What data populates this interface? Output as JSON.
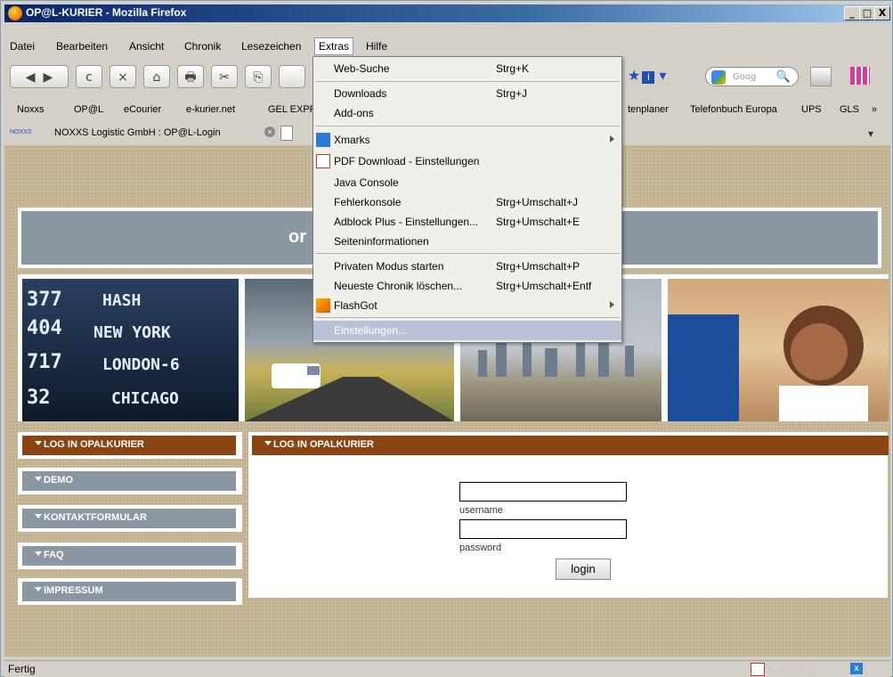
{
  "window": {
    "title": "OP@L-KURIER - Mozilla Firefox",
    "controls": {
      "minimize": "_",
      "maximize": "□",
      "close": "X"
    }
  },
  "menubar": {
    "items": [
      {
        "label": "Datei"
      },
      {
        "label": "Bearbeiten"
      },
      {
        "label": "Ansicht"
      },
      {
        "label": "Chronik"
      },
      {
        "label": "Lesezeichen"
      },
      {
        "label": "Extras"
      },
      {
        "label": "Hilfe"
      }
    ]
  },
  "toolbar": {
    "back": "◀",
    "forward": "▶",
    "reload": "c",
    "stop": "×",
    "home": "⌂",
    "print": "🖶",
    "cut": "✂",
    "copy": "⎘",
    "search_placeholder": "Goog",
    "search_icon": "🔍"
  },
  "bookmarks": [
    "Noxxs",
    "OP@L",
    "eCourier",
    "e-kurier.net",
    "GEL EXPR",
    "tenplaner",
    "Telefonbuch Europa",
    "UPS",
    "GLS",
    "»"
  ],
  "tab": {
    "favicon_text": "NOXXS",
    "label": "NOXXS Logistic GmbH : OP@L-Login"
  },
  "extras_menu": {
    "items": [
      {
        "label": "Web-Suche",
        "shortcut": "Strg+K"
      },
      {
        "label": "Downloads",
        "shortcut": "Strg+J"
      },
      {
        "label": "Add-ons",
        "shortcut": ""
      },
      {
        "label": "Xmarks",
        "shortcut": "",
        "submenu": true
      },
      {
        "label": "PDF Download - Einstellungen",
        "shortcut": ""
      },
      {
        "label": "Java Console",
        "shortcut": ""
      },
      {
        "label": "Fehlerkonsole",
        "shortcut": "Strg+Umschalt+J"
      },
      {
        "label": "Adblock Plus - Einstellungen...",
        "shortcut": "Strg+Umschalt+E"
      },
      {
        "label": "Seiteninformationen",
        "shortcut": ""
      },
      {
        "label": "Privaten Modus starten",
        "shortcut": "Strg+Umschalt+P"
      },
      {
        "label": "Neueste Chronik löschen...",
        "shortcut": "Strg+Umschalt+Entf"
      },
      {
        "label": "FlashGot",
        "shortcut": "",
        "submenu": true
      },
      {
        "label": "Einstellungen...",
        "shortcut": ""
      }
    ]
  },
  "page": {
    "banner_text": "or",
    "photo_text": {
      "board_numbers": [
        "377",
        "404",
        "717",
        "32"
      ],
      "cities": [
        "HASH",
        "NEW YORK",
        "LONDON-6",
        "CHICAGO"
      ]
    },
    "sidebar": [
      {
        "label": "LOG IN OPALKURIER",
        "active": true
      },
      {
        "label": "DEMO",
        "active": false
      },
      {
        "label": "KONTAKTFORMULAR",
        "active": false
      },
      {
        "label": "FAQ",
        "active": false
      },
      {
        "label": "IMPRESSUM",
        "active": false
      }
    ],
    "login": {
      "heading": "LOG IN OPALKURIER",
      "username_label": "username",
      "password_label": "password",
      "username_value": "",
      "password_value": "",
      "button": "login"
    }
  },
  "statusbar": {
    "text": "Fertig",
    "stars": "☆☆☆☆☆"
  }
}
